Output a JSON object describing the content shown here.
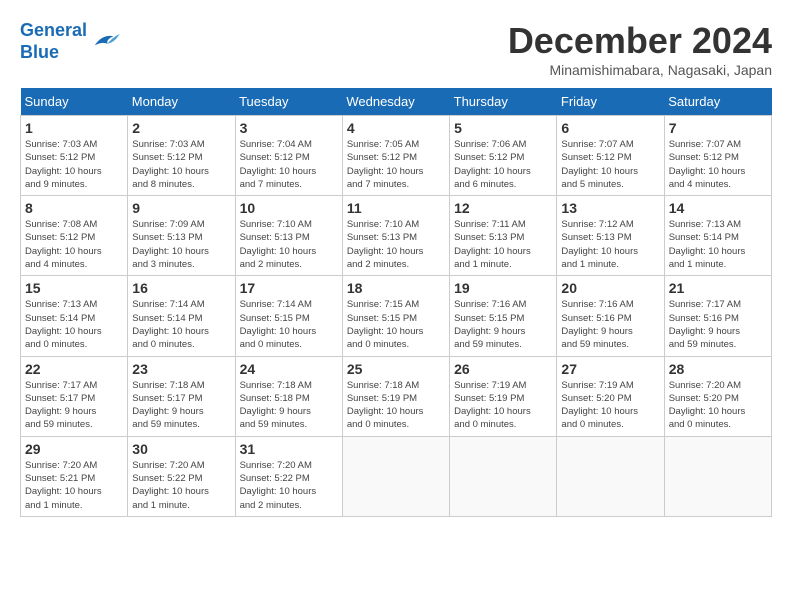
{
  "logo": {
    "line1": "General",
    "line2": "Blue"
  },
  "title": "December 2024",
  "location": "Minamishimabara, Nagasaki, Japan",
  "weekdays": [
    "Sunday",
    "Monday",
    "Tuesday",
    "Wednesday",
    "Thursday",
    "Friday",
    "Saturday"
  ],
  "weeks": [
    [
      {
        "day": "1",
        "info": "Sunrise: 7:03 AM\nSunset: 5:12 PM\nDaylight: 10 hours\nand 9 minutes."
      },
      {
        "day": "2",
        "info": "Sunrise: 7:03 AM\nSunset: 5:12 PM\nDaylight: 10 hours\nand 8 minutes."
      },
      {
        "day": "3",
        "info": "Sunrise: 7:04 AM\nSunset: 5:12 PM\nDaylight: 10 hours\nand 7 minutes."
      },
      {
        "day": "4",
        "info": "Sunrise: 7:05 AM\nSunset: 5:12 PM\nDaylight: 10 hours\nand 7 minutes."
      },
      {
        "day": "5",
        "info": "Sunrise: 7:06 AM\nSunset: 5:12 PM\nDaylight: 10 hours\nand 6 minutes."
      },
      {
        "day": "6",
        "info": "Sunrise: 7:07 AM\nSunset: 5:12 PM\nDaylight: 10 hours\nand 5 minutes."
      },
      {
        "day": "7",
        "info": "Sunrise: 7:07 AM\nSunset: 5:12 PM\nDaylight: 10 hours\nand 4 minutes."
      }
    ],
    [
      {
        "day": "8",
        "info": "Sunrise: 7:08 AM\nSunset: 5:12 PM\nDaylight: 10 hours\nand 4 minutes."
      },
      {
        "day": "9",
        "info": "Sunrise: 7:09 AM\nSunset: 5:13 PM\nDaylight: 10 hours\nand 3 minutes."
      },
      {
        "day": "10",
        "info": "Sunrise: 7:10 AM\nSunset: 5:13 PM\nDaylight: 10 hours\nand 2 minutes."
      },
      {
        "day": "11",
        "info": "Sunrise: 7:10 AM\nSunset: 5:13 PM\nDaylight: 10 hours\nand 2 minutes."
      },
      {
        "day": "12",
        "info": "Sunrise: 7:11 AM\nSunset: 5:13 PM\nDaylight: 10 hours\nand 1 minute."
      },
      {
        "day": "13",
        "info": "Sunrise: 7:12 AM\nSunset: 5:13 PM\nDaylight: 10 hours\nand 1 minute."
      },
      {
        "day": "14",
        "info": "Sunrise: 7:13 AM\nSunset: 5:14 PM\nDaylight: 10 hours\nand 1 minute."
      }
    ],
    [
      {
        "day": "15",
        "info": "Sunrise: 7:13 AM\nSunset: 5:14 PM\nDaylight: 10 hours\nand 0 minutes."
      },
      {
        "day": "16",
        "info": "Sunrise: 7:14 AM\nSunset: 5:14 PM\nDaylight: 10 hours\nand 0 minutes."
      },
      {
        "day": "17",
        "info": "Sunrise: 7:14 AM\nSunset: 5:15 PM\nDaylight: 10 hours\nand 0 minutes."
      },
      {
        "day": "18",
        "info": "Sunrise: 7:15 AM\nSunset: 5:15 PM\nDaylight: 10 hours\nand 0 minutes."
      },
      {
        "day": "19",
        "info": "Sunrise: 7:16 AM\nSunset: 5:15 PM\nDaylight: 9 hours\nand 59 minutes."
      },
      {
        "day": "20",
        "info": "Sunrise: 7:16 AM\nSunset: 5:16 PM\nDaylight: 9 hours\nand 59 minutes."
      },
      {
        "day": "21",
        "info": "Sunrise: 7:17 AM\nSunset: 5:16 PM\nDaylight: 9 hours\nand 59 minutes."
      }
    ],
    [
      {
        "day": "22",
        "info": "Sunrise: 7:17 AM\nSunset: 5:17 PM\nDaylight: 9 hours\nand 59 minutes."
      },
      {
        "day": "23",
        "info": "Sunrise: 7:18 AM\nSunset: 5:17 PM\nDaylight: 9 hours\nand 59 minutes."
      },
      {
        "day": "24",
        "info": "Sunrise: 7:18 AM\nSunset: 5:18 PM\nDaylight: 9 hours\nand 59 minutes."
      },
      {
        "day": "25",
        "info": "Sunrise: 7:18 AM\nSunset: 5:19 PM\nDaylight: 10 hours\nand 0 minutes."
      },
      {
        "day": "26",
        "info": "Sunrise: 7:19 AM\nSunset: 5:19 PM\nDaylight: 10 hours\nand 0 minutes."
      },
      {
        "day": "27",
        "info": "Sunrise: 7:19 AM\nSunset: 5:20 PM\nDaylight: 10 hours\nand 0 minutes."
      },
      {
        "day": "28",
        "info": "Sunrise: 7:20 AM\nSunset: 5:20 PM\nDaylight: 10 hours\nand 0 minutes."
      }
    ],
    [
      {
        "day": "29",
        "info": "Sunrise: 7:20 AM\nSunset: 5:21 PM\nDaylight: 10 hours\nand 1 minute."
      },
      {
        "day": "30",
        "info": "Sunrise: 7:20 AM\nSunset: 5:22 PM\nDaylight: 10 hours\nand 1 minute."
      },
      {
        "day": "31",
        "info": "Sunrise: 7:20 AM\nSunset: 5:22 PM\nDaylight: 10 hours\nand 2 minutes."
      },
      null,
      null,
      null,
      null
    ]
  ]
}
